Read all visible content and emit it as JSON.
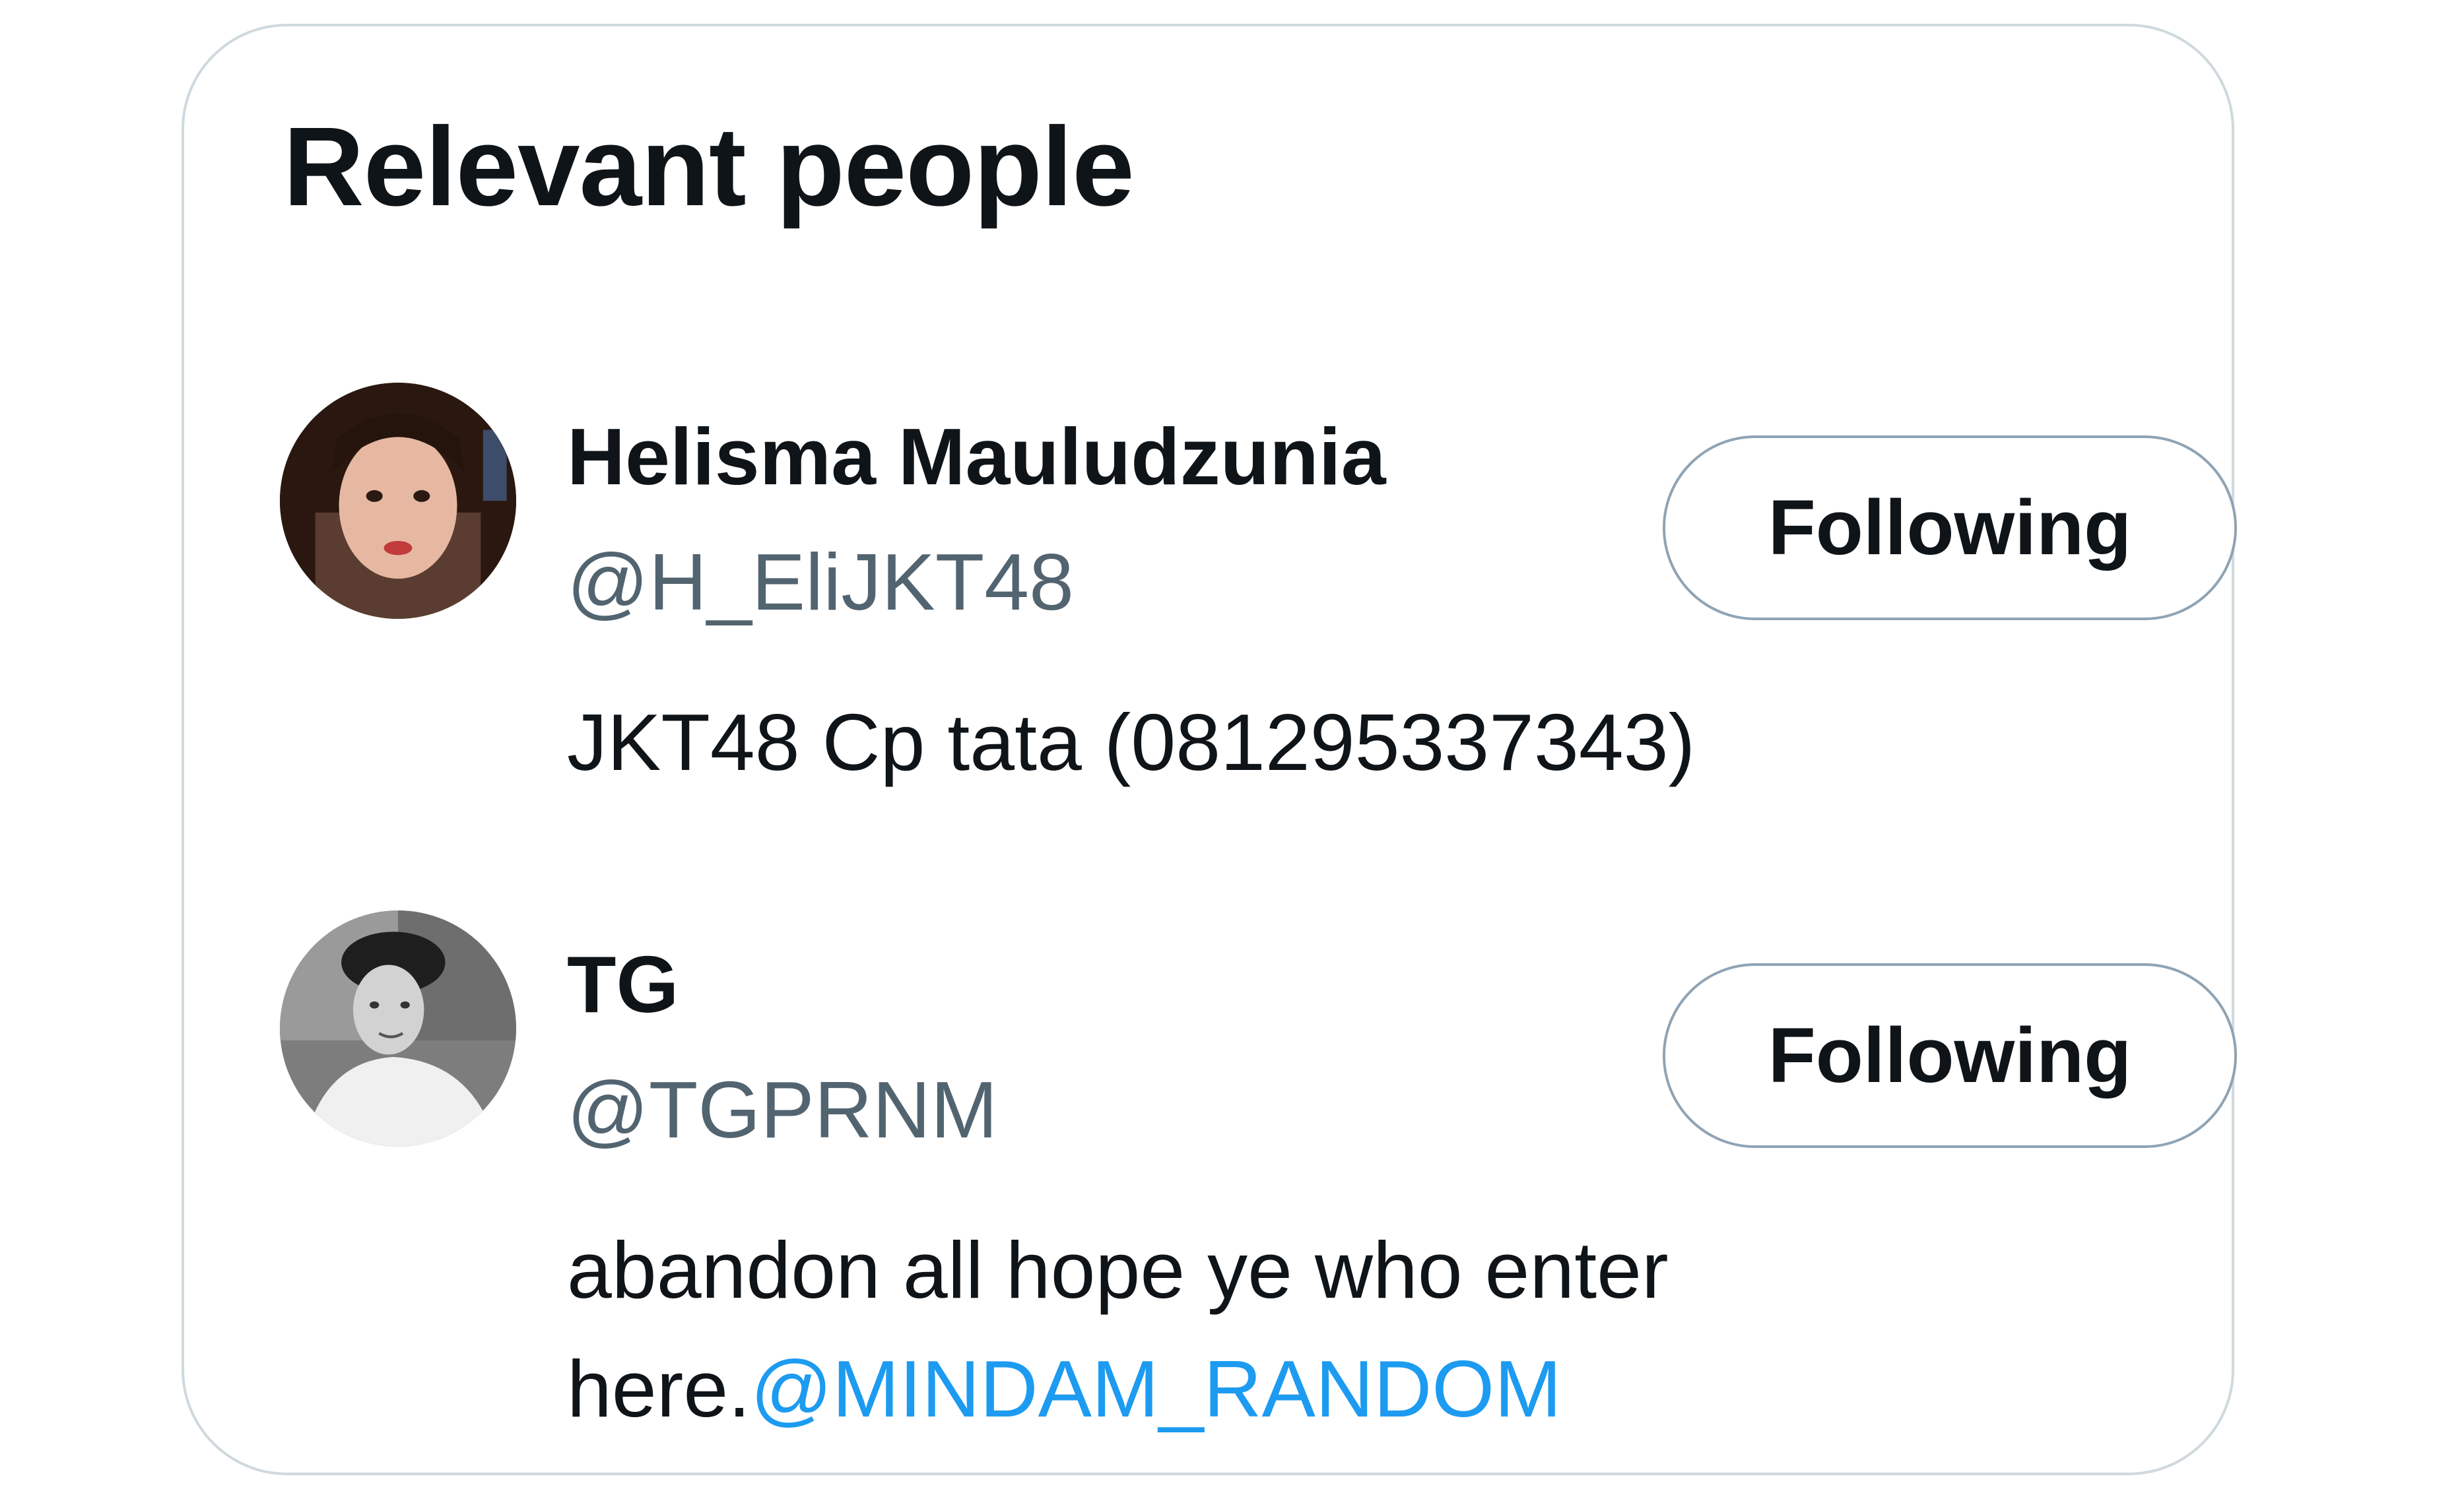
{
  "panel": {
    "title": "Relevant people"
  },
  "people": [
    {
      "name": "Helisma Mauludzunia",
      "handle": "@H_EliJKT48",
      "bio": "JKT48 Cp tata (081295337343)",
      "bio_mention": "",
      "button_label": "Following",
      "avatar_icon": "user-photo-avatar"
    },
    {
      "name": "TG",
      "handle": "@TGPRNM",
      "bio": "abandon all hope ye who enter here.",
      "bio_mention": "@MINDAM_RANDOM",
      "button_label": "Following",
      "avatar_icon": "user-photo-avatar"
    }
  ],
  "colors": {
    "text_primary": "#0f1419",
    "text_secondary": "#536471",
    "link": "#1d9bf0",
    "border": "#cfd9de"
  }
}
